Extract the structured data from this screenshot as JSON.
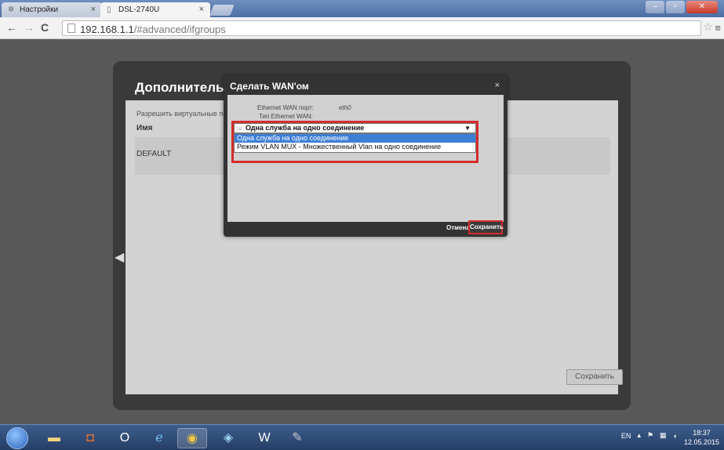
{
  "browser": {
    "tabs": [
      {
        "label": "Настройки",
        "icon": "gear-icon"
      },
      {
        "label": "DSL-2740U",
        "icon": "page-icon"
      }
    ],
    "url_host": "192.168.1.1",
    "url_path": "/#advanced/ifgroups"
  },
  "panel": {
    "title": "Дополнительно",
    "title_suffix": "›",
    "allow_text": "Разрешить виртуальные порт",
    "column_name": "Имя",
    "row_name": "DEFAULT",
    "save_label": "Сохранить"
  },
  "modal": {
    "title": "Сделать WAN'ом",
    "close": "×",
    "ethernet_wan_port_label": "Ethernet WAN порт:",
    "ethernet_wan_port_value": "eth0",
    "ethernet_wan_type_label": "Тип Ethernet WAN:",
    "select_value": "Одна служба на одно соединение",
    "options": [
      "Одна служба на одно соединение",
      "Режим VLAN MUX - Множественный Vlan на одно соединение"
    ],
    "cancel_label": "Отмена",
    "save_label": "Сохранить"
  },
  "taskbar": {
    "lang": "EN",
    "time": "18:37",
    "date": "12.05.2015"
  }
}
